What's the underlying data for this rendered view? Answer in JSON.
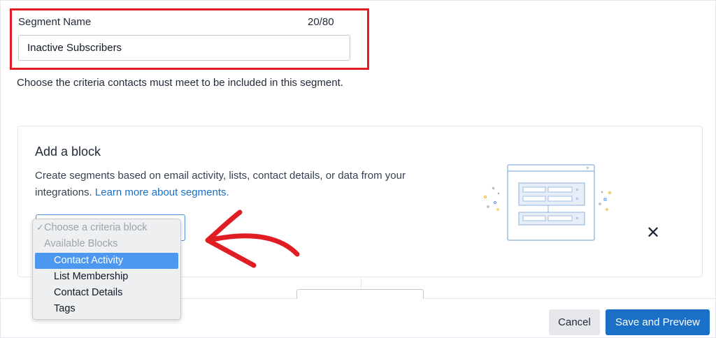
{
  "segment": {
    "name_label": "Segment Name",
    "char_count": "20/80",
    "name_value": "Inactive Subscribers"
  },
  "helper_text": "Choose the criteria contacts must meet to be included in this segment.",
  "add_block": {
    "title": "Add a block",
    "description_line1": "Create segments based on email activity, lists, contact details, or data from your",
    "description_line2": "integrations.",
    "learn_more_link": "Learn more about segments."
  },
  "criteria_dropdown": {
    "check_mark": "✓",
    "placeholder": "Choose a criteria block",
    "group_label": "Available Blocks",
    "options": [
      "Contact Activity",
      "List Membership",
      "Contact Details",
      "Tags"
    ],
    "selected_option": "Contact Activity"
  },
  "close_glyph": "✕",
  "footer": {
    "cancel_label": "Cancel",
    "save_label": "Save and Preview"
  },
  "colors": {
    "highlight_border": "#e11d24",
    "primary_button": "#1a6fc7",
    "link": "#1a6fc7",
    "selected_option_bg": "#4c97f0",
    "annotation_arrow": "#e11d24"
  },
  "icons": {
    "close": "close-icon",
    "annotation_arrow": "red-arrow-annotation",
    "illustration": "segment-builder-illustration"
  }
}
